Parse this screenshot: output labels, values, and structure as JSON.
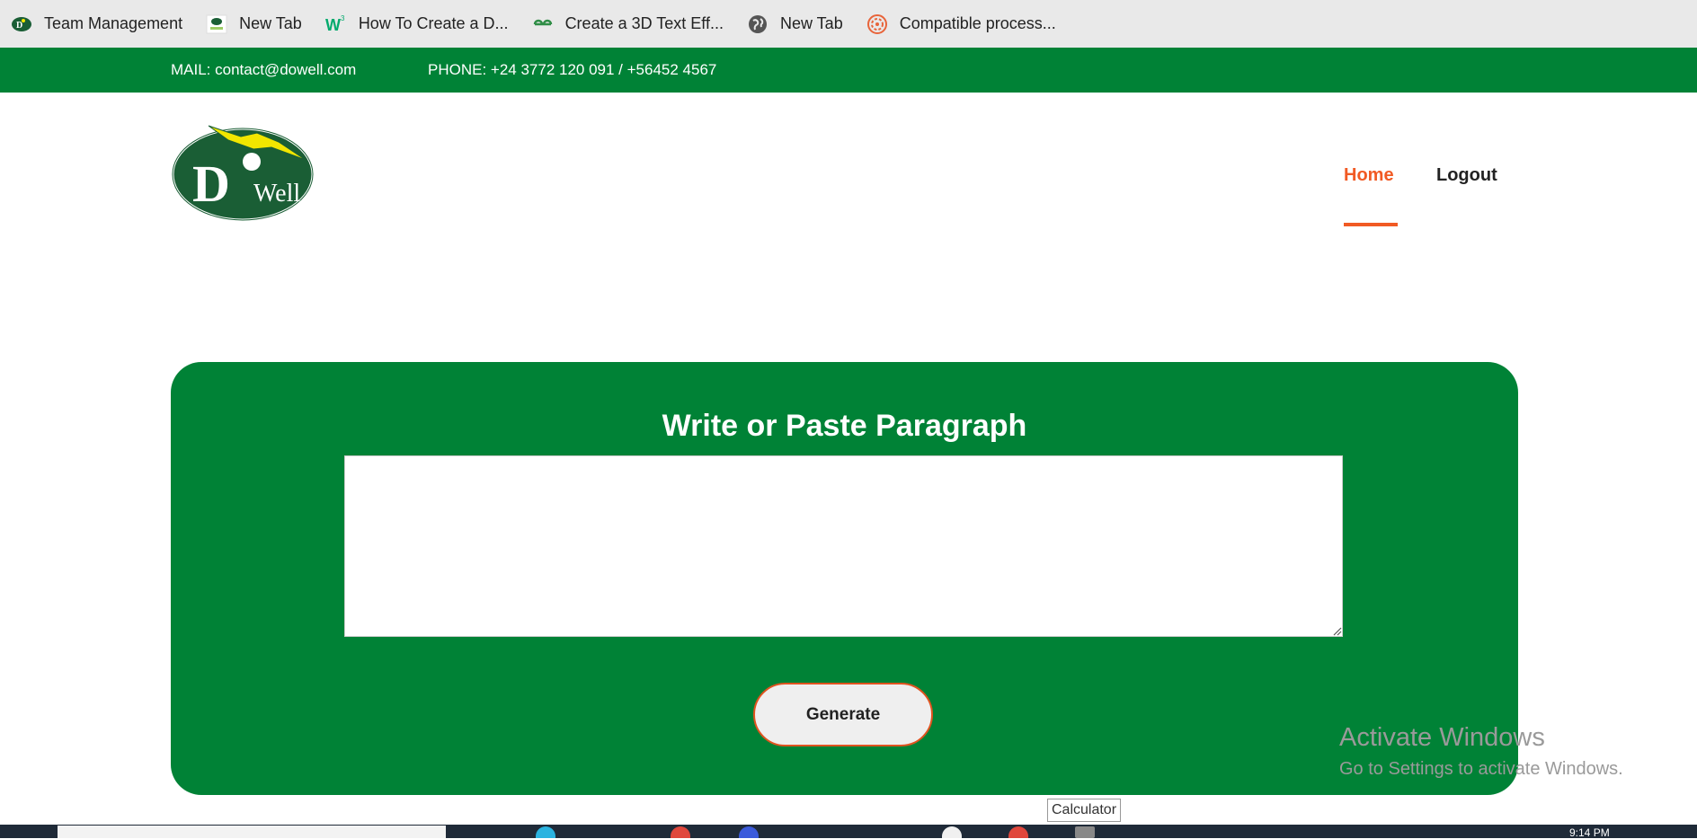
{
  "bookmarks": [
    {
      "label": "Team Management",
      "icon": "dowell-icon"
    },
    {
      "label": "New Tab",
      "icon": "dowell-small-icon"
    },
    {
      "label": "How To Create a D...",
      "icon": "w3schools-icon"
    },
    {
      "label": "Create a 3D Text Eff...",
      "icon": "geeksforgeeks-icon"
    },
    {
      "label": "New Tab",
      "icon": "globe-icon"
    },
    {
      "label": "Compatible process...",
      "icon": "spiral-icon"
    }
  ],
  "topbar": {
    "mail": "MAIL: contact@dowell.com",
    "phone": "PHONE: +24 3772 120 091 / +56452 4567"
  },
  "logo": {
    "letter": "D",
    "word": "Well"
  },
  "nav": {
    "home": "Home",
    "logout": "Logout"
  },
  "card": {
    "title": "Write or Paste Paragraph",
    "paragraph_value": "",
    "generate_label": "Generate"
  },
  "watermark": {
    "line1": "Activate Windows",
    "line2": "Go to Settings to activate Windows."
  },
  "tooltip": "Calculator",
  "taskbar": {
    "time": "9:14 PM"
  },
  "colors": {
    "brand_green": "#008236",
    "accent_orange": "#f15a24",
    "logo_green": "#1a5e35",
    "logo_yellow": "#f2e600"
  }
}
